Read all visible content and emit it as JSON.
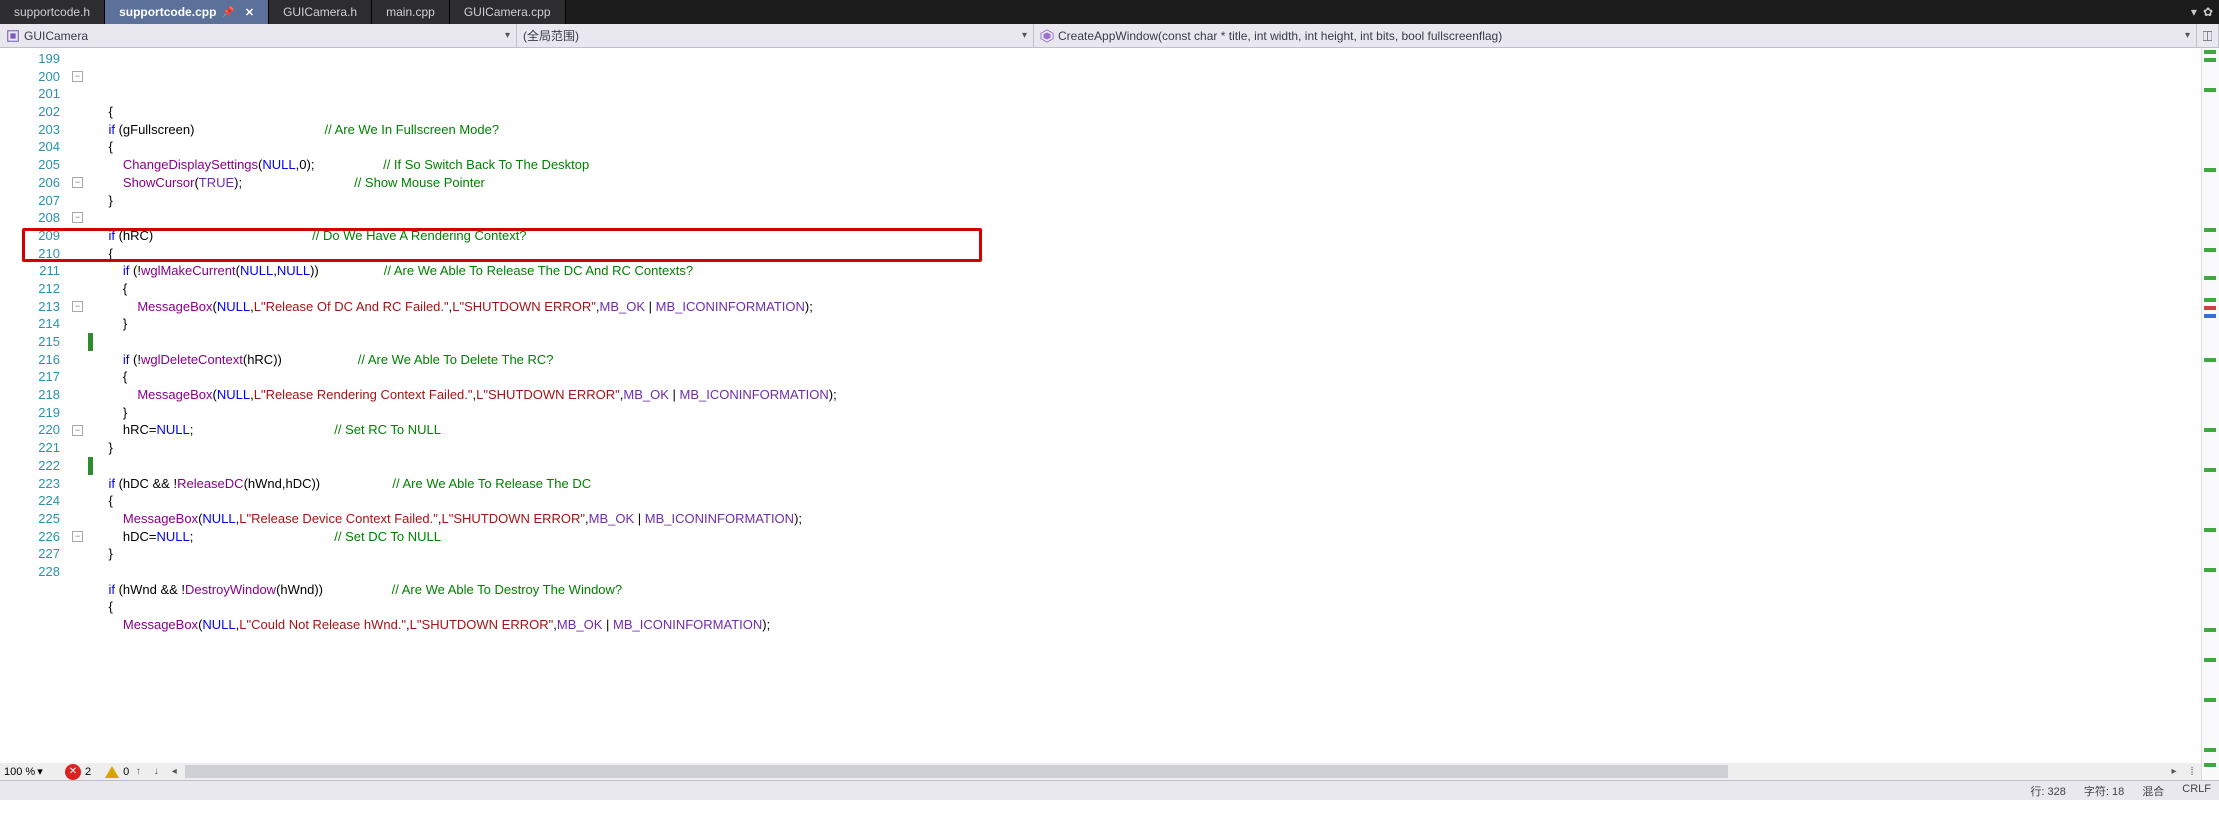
{
  "tabs": [
    {
      "label": "supportcode.h",
      "active": false,
      "pinned": false
    },
    {
      "label": "supportcode.cpp",
      "active": true,
      "pinned": true
    },
    {
      "label": "GUICamera.h",
      "active": false,
      "pinned": false
    },
    {
      "label": "main.cpp",
      "active": false,
      "pinned": false
    },
    {
      "label": "GUICamera.cpp",
      "active": false,
      "pinned": false
    }
  ],
  "nav": {
    "class_context": "GUICamera",
    "scope": "(全局范围)",
    "function": "CreateAppWindow(const char * title, int width, int height, int bits, bool fullscreenflag)"
  },
  "first_line_number": 199,
  "line_count": 30,
  "highlighted_line": 210,
  "code_lines": [
    {
      "n": 199,
      "tokens": [
        {
          "t": "    {",
          "c": ""
        }
      ]
    },
    {
      "n": 200,
      "tokens": [
        {
          "t": "    ",
          "c": ""
        },
        {
          "t": "if",
          "c": "kw"
        },
        {
          "t": " (gFullscreen)                                    ",
          "c": ""
        },
        {
          "t": "// Are We In Fullscreen Mode?",
          "c": "cm"
        }
      ]
    },
    {
      "n": 201,
      "tokens": [
        {
          "t": "    {",
          "c": ""
        }
      ]
    },
    {
      "n": 202,
      "tokens": [
        {
          "t": "        ",
          "c": ""
        },
        {
          "t": "ChangeDisplaySettings",
          "c": "fn"
        },
        {
          "t": "(",
          "c": ""
        },
        {
          "t": "NULL",
          "c": "kw"
        },
        {
          "t": ",",
          "c": ""
        },
        {
          "t": "0",
          "c": "num"
        },
        {
          "t": ");                   ",
          "c": ""
        },
        {
          "t": "// If So Switch Back To The Desktop",
          "c": "cm"
        }
      ]
    },
    {
      "n": 203,
      "tokens": [
        {
          "t": "        ",
          "c": ""
        },
        {
          "t": "ShowCursor",
          "c": "fn"
        },
        {
          "t": "(",
          "c": ""
        },
        {
          "t": "TRUE",
          "c": "mac"
        },
        {
          "t": ");                               ",
          "c": ""
        },
        {
          "t": "// Show Mouse Pointer",
          "c": "cm"
        }
      ]
    },
    {
      "n": 204,
      "tokens": [
        {
          "t": "    }",
          "c": ""
        }
      ]
    },
    {
      "n": 205,
      "tokens": [
        {
          "t": "",
          "c": ""
        }
      ]
    },
    {
      "n": 206,
      "tokens": [
        {
          "t": "    ",
          "c": ""
        },
        {
          "t": "if",
          "c": "kw"
        },
        {
          "t": " (hRC)                                            ",
          "c": ""
        },
        {
          "t": "// Do We Have A Rendering Context?",
          "c": "cm"
        }
      ]
    },
    {
      "n": 207,
      "tokens": [
        {
          "t": "    {",
          "c": ""
        }
      ]
    },
    {
      "n": 208,
      "tokens": [
        {
          "t": "        ",
          "c": ""
        },
        {
          "t": "if",
          "c": "kw"
        },
        {
          "t": " (!",
          "c": ""
        },
        {
          "t": "wglMakeCurrent",
          "c": "fn"
        },
        {
          "t": "(",
          "c": ""
        },
        {
          "t": "NULL",
          "c": "kw"
        },
        {
          "t": ",",
          "c": ""
        },
        {
          "t": "NULL",
          "c": "kw"
        },
        {
          "t": "))                  ",
          "c": ""
        },
        {
          "t": "// Are We Able To Release The DC And RC Contexts?",
          "c": "cm"
        }
      ]
    },
    {
      "n": 209,
      "tokens": [
        {
          "t": "        {",
          "c": ""
        }
      ]
    },
    {
      "n": 210,
      "tokens": [
        {
          "t": "            ",
          "c": ""
        },
        {
          "t": "MessageBox",
          "c": "fn"
        },
        {
          "t": "(",
          "c": ""
        },
        {
          "t": "NULL",
          "c": "kw"
        },
        {
          "t": ",",
          "c": ""
        },
        {
          "t": "L\"Release Of DC And RC Failed.\"",
          "c": "str"
        },
        {
          "t": ",",
          "c": ""
        },
        {
          "t": "L\"SHUTDOWN ERROR\"",
          "c": "str"
        },
        {
          "t": ",",
          "c": ""
        },
        {
          "t": "MB_OK",
          "c": "mac"
        },
        {
          "t": " | ",
          "c": ""
        },
        {
          "t": "MB_ICONINFORMATION",
          "c": "mac"
        },
        {
          "t": ");",
          "c": ""
        }
      ]
    },
    {
      "n": 211,
      "tokens": [
        {
          "t": "        }",
          "c": ""
        }
      ]
    },
    {
      "n": 212,
      "tokens": [
        {
          "t": "",
          "c": ""
        }
      ]
    },
    {
      "n": 213,
      "tokens": [
        {
          "t": "        ",
          "c": ""
        },
        {
          "t": "if",
          "c": "kw"
        },
        {
          "t": " (!",
          "c": ""
        },
        {
          "t": "wglDeleteContext",
          "c": "fn"
        },
        {
          "t": "(hRC))                     ",
          "c": ""
        },
        {
          "t": "// Are We Able To Delete The RC?",
          "c": "cm"
        }
      ]
    },
    {
      "n": 214,
      "tokens": [
        {
          "t": "        {",
          "c": ""
        }
      ]
    },
    {
      "n": 215,
      "tokens": [
        {
          "t": "            ",
          "c": ""
        },
        {
          "t": "MessageBox",
          "c": "fn"
        },
        {
          "t": "(",
          "c": ""
        },
        {
          "t": "NULL",
          "c": "kw"
        },
        {
          "t": ",",
          "c": ""
        },
        {
          "t": "L\"Release Rendering Context Failed.\"",
          "c": "str"
        },
        {
          "t": ",",
          "c": ""
        },
        {
          "t": "L\"SHUTDOWN ERROR\"",
          "c": "str"
        },
        {
          "t": ",",
          "c": ""
        },
        {
          "t": "MB_OK",
          "c": "mac"
        },
        {
          "t": " | ",
          "c": ""
        },
        {
          "t": "MB_ICONINFORMATION",
          "c": "mac"
        },
        {
          "t": ");",
          "c": ""
        }
      ]
    },
    {
      "n": 216,
      "tokens": [
        {
          "t": "        }",
          "c": ""
        }
      ]
    },
    {
      "n": 217,
      "tokens": [
        {
          "t": "        hRC=",
          "c": ""
        },
        {
          "t": "NULL",
          "c": "kw"
        },
        {
          "t": ";                                       ",
          "c": ""
        },
        {
          "t": "// Set RC To NULL",
          "c": "cm"
        }
      ]
    },
    {
      "n": 218,
      "tokens": [
        {
          "t": "    }",
          "c": ""
        }
      ]
    },
    {
      "n": 219,
      "tokens": [
        {
          "t": "",
          "c": ""
        }
      ]
    },
    {
      "n": 220,
      "tokens": [
        {
          "t": "    ",
          "c": ""
        },
        {
          "t": "if",
          "c": "kw"
        },
        {
          "t": " (hDC && !",
          "c": ""
        },
        {
          "t": "ReleaseDC",
          "c": "fn"
        },
        {
          "t": "(hWnd,hDC))                    ",
          "c": ""
        },
        {
          "t": "// Are We Able To Release The DC",
          "c": "cm"
        }
      ]
    },
    {
      "n": 221,
      "tokens": [
        {
          "t": "    {",
          "c": ""
        }
      ]
    },
    {
      "n": 222,
      "tokens": [
        {
          "t": "        ",
          "c": ""
        },
        {
          "t": "MessageBox",
          "c": "fn"
        },
        {
          "t": "(",
          "c": ""
        },
        {
          "t": "NULL",
          "c": "kw"
        },
        {
          "t": ",",
          "c": ""
        },
        {
          "t": "L\"Release Device Context Failed.\"",
          "c": "str"
        },
        {
          "t": ",",
          "c": ""
        },
        {
          "t": "L\"SHUTDOWN ERROR\"",
          "c": "str"
        },
        {
          "t": ",",
          "c": ""
        },
        {
          "t": "MB_OK",
          "c": "mac"
        },
        {
          "t": " | ",
          "c": ""
        },
        {
          "t": "MB_ICONINFORMATION",
          "c": "mac"
        },
        {
          "t": ");",
          "c": ""
        }
      ]
    },
    {
      "n": 223,
      "tokens": [
        {
          "t": "        hDC=",
          "c": ""
        },
        {
          "t": "NULL",
          "c": "kw"
        },
        {
          "t": ";                                       ",
          "c": ""
        },
        {
          "t": "// Set DC To NULL",
          "c": "cm"
        }
      ]
    },
    {
      "n": 224,
      "tokens": [
        {
          "t": "    }",
          "c": ""
        }
      ]
    },
    {
      "n": 225,
      "tokens": [
        {
          "t": "",
          "c": ""
        }
      ]
    },
    {
      "n": 226,
      "tokens": [
        {
          "t": "    ",
          "c": ""
        },
        {
          "t": "if",
          "c": "kw"
        },
        {
          "t": " (hWnd && !",
          "c": ""
        },
        {
          "t": "DestroyWindow",
          "c": "fn"
        },
        {
          "t": "(hWnd))                   ",
          "c": ""
        },
        {
          "t": "// Are We Able To Destroy The Window?",
          "c": "cm"
        }
      ]
    },
    {
      "n": 227,
      "tokens": [
        {
          "t": "    {",
          "c": ""
        }
      ]
    },
    {
      "n": 228,
      "tokens": [
        {
          "t": "        ",
          "c": ""
        },
        {
          "t": "MessageBox",
          "c": "fn"
        },
        {
          "t": "(",
          "c": ""
        },
        {
          "t": "NULL",
          "c": "kw"
        },
        {
          "t": ",",
          "c": ""
        },
        {
          "t": "L\"Could Not Release hWnd.\"",
          "c": "str"
        },
        {
          "t": ",",
          "c": ""
        },
        {
          "t": "L\"SHUTDOWN ERROR\"",
          "c": "str"
        },
        {
          "t": ",",
          "c": ""
        },
        {
          "t": "MB_OK",
          "c": "mac"
        },
        {
          "t": " | ",
          "c": ""
        },
        {
          "t": "MB_ICONINFORMATION",
          "c": "mac"
        },
        {
          "t": ");",
          "c": ""
        }
      ]
    }
  ],
  "fold_markers_at_lines": [
    200,
    206,
    208,
    213,
    220,
    226
  ],
  "change_marks_at_lines": [
    215,
    222
  ],
  "overview_ticks": [
    {
      "pos": 2,
      "c": "g"
    },
    {
      "pos": 10,
      "c": "g"
    },
    {
      "pos": 40,
      "c": "g"
    },
    {
      "pos": 120,
      "c": "g"
    },
    {
      "pos": 180,
      "c": "g"
    },
    {
      "pos": 200,
      "c": "g"
    },
    {
      "pos": 228,
      "c": "g"
    },
    {
      "pos": 250,
      "c": "g"
    },
    {
      "pos": 258,
      "c": "r"
    },
    {
      "pos": 266,
      "c": "b"
    },
    {
      "pos": 310,
      "c": "g"
    },
    {
      "pos": 380,
      "c": "g"
    },
    {
      "pos": 420,
      "c": "g"
    },
    {
      "pos": 480,
      "c": "g"
    },
    {
      "pos": 520,
      "c": "g"
    },
    {
      "pos": 580,
      "c": "g"
    },
    {
      "pos": 610,
      "c": "g"
    },
    {
      "pos": 650,
      "c": "g"
    },
    {
      "pos": 700,
      "c": "g"
    },
    {
      "pos": 715,
      "c": "g"
    }
  ],
  "hscroll": {
    "zoom": "100 %",
    "errors": "2",
    "warnings": "0"
  },
  "status": {
    "line_label": "行:",
    "line_val": "328",
    "char_label": "字符:",
    "char_val": "18",
    "mode": "混合",
    "crlf": "CRLF"
  }
}
